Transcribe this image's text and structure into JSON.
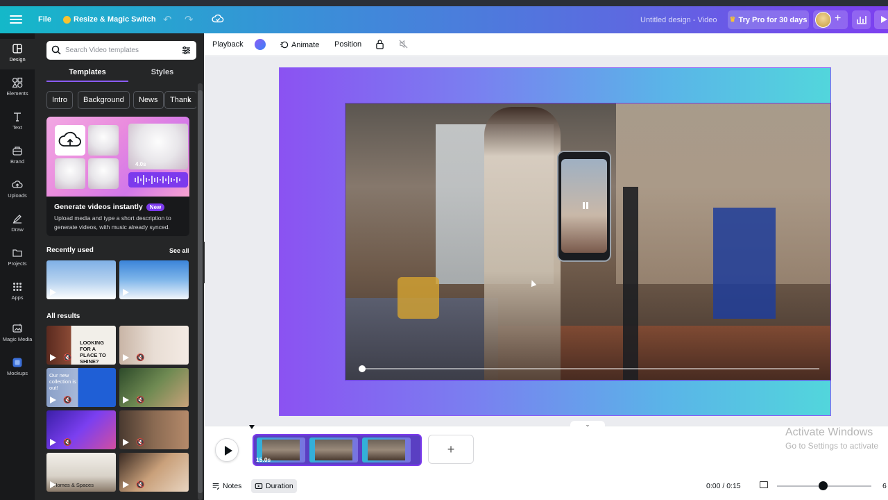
{
  "header": {
    "file_label": "File",
    "resize_label": "Resize & Magic Switch",
    "doc_title": "Untitled design - Video",
    "try_pro_label": "Try Pro for 30 days"
  },
  "rail": {
    "items": [
      {
        "label": "Design",
        "icon": "design-icon"
      },
      {
        "label": "Elements",
        "icon": "elements-icon"
      },
      {
        "label": "Text",
        "icon": "text-icon"
      },
      {
        "label": "Brand",
        "icon": "brand-icon"
      },
      {
        "label": "Uploads",
        "icon": "uploads-icon"
      },
      {
        "label": "Draw",
        "icon": "draw-icon"
      },
      {
        "label": "Projects",
        "icon": "projects-icon"
      },
      {
        "label": "Apps",
        "icon": "apps-icon"
      },
      {
        "label": "Magic Media",
        "icon": "magic-media-icon"
      },
      {
        "label": "Mockups",
        "icon": "mockups-icon"
      }
    ]
  },
  "panel": {
    "search_placeholder": "Search Video templates",
    "tabs": [
      "Templates",
      "Styles"
    ],
    "chips": [
      "Intro",
      "Background",
      "News",
      "Thank"
    ],
    "promo_title": "Generate videos instantly",
    "promo_badge": "New",
    "promo_desc": "Upload media and type a short description to generate videos, with music already synced.",
    "promo_time": "4.0s",
    "recently_used": "Recently used",
    "see_all": "See all",
    "all_results": "All results",
    "result_texts": {
      "r1": "LOOKING FOR A PLACE TO SHINE?",
      "r3": "Our new collection is out!",
      "r8": "Homes & Spaces"
    }
  },
  "toolbar": {
    "playback": "Playback",
    "animate": "Animate",
    "position": "Position"
  },
  "timeline": {
    "clip_duration": "15.0s",
    "notes": "Notes",
    "duration": "Duration",
    "timer": "0:00 / 0:15",
    "zoom": "6"
  },
  "watermark": {
    "line1": "Activate Windows",
    "line2": "Go to Settings to activate"
  },
  "colors": {
    "accent": "#7c3aed",
    "canvas_gradient_start": "#8b52f2",
    "canvas_gradient_end": "#52d6dc"
  }
}
